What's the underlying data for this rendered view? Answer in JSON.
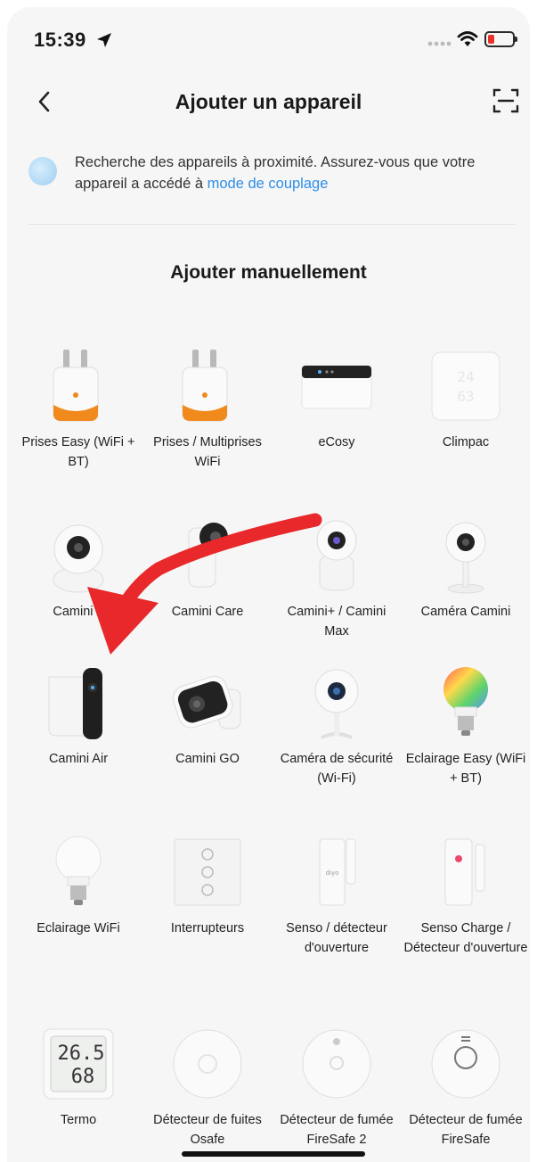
{
  "status_bar": {
    "time": "15:39"
  },
  "header": {
    "title": "Ajouter un appareil"
  },
  "notice": {
    "text": "Recherche des appareils à proximité. Assurez-vous que votre appareil a accédé à ",
    "link": "mode de couplage"
  },
  "section": {
    "title": "Ajouter manuellement"
  },
  "devices": [
    {
      "label": "Prises Easy (WiFi + BT)",
      "icon": "smart-plug"
    },
    {
      "label": "Prises / Multiprises WiFi",
      "icon": "smart-plug"
    },
    {
      "label": "eCosy",
      "icon": "thermostat-box"
    },
    {
      "label": "Climpac",
      "icon": "climate-display"
    },
    {
      "label": "Camini 2",
      "icon": "ptz-camera"
    },
    {
      "label": "Camini Care",
      "icon": "baby-camera"
    },
    {
      "label": "Camini+ / Camini Max",
      "icon": "dome-camera"
    },
    {
      "label": "Caméra Camini",
      "icon": "stand-camera"
    },
    {
      "label": "Camini Air",
      "icon": "outdoor-camera"
    },
    {
      "label": "Camini GO",
      "icon": "wall-camera"
    },
    {
      "label": "Caméra de sécurité (Wi-Fi)",
      "icon": "security-camera"
    },
    {
      "label": "Eclairage Easy (WiFi + BT)",
      "icon": "color-bulb"
    },
    {
      "label": "Eclairage WiFi",
      "icon": "white-bulb"
    },
    {
      "label": "Interrupteurs",
      "icon": "wall-switch"
    },
    {
      "label": "Senso / détecteur d'ouverture",
      "icon": "door-sensor"
    },
    {
      "label": "Senso Charge / Détecteur d'ouverture",
      "icon": "door-sensor-charge"
    },
    {
      "label": "Termo",
      "icon": "thermo-hygrometer"
    },
    {
      "label": "Détecteur de fuites Osafe",
      "icon": "leak-detector"
    },
    {
      "label": "Détecteur de fumée FireSafe 2",
      "icon": "smoke-detector"
    },
    {
      "label": "Détecteur de fumée FireSafe",
      "icon": "smoke-detector-2"
    }
  ],
  "termo_display": {
    "temp": "26.5",
    "hum": "68"
  },
  "colors": {
    "accent": "#2d8ee8",
    "annotation": "#e8282a",
    "plug_orange": "#f08a1c"
  }
}
